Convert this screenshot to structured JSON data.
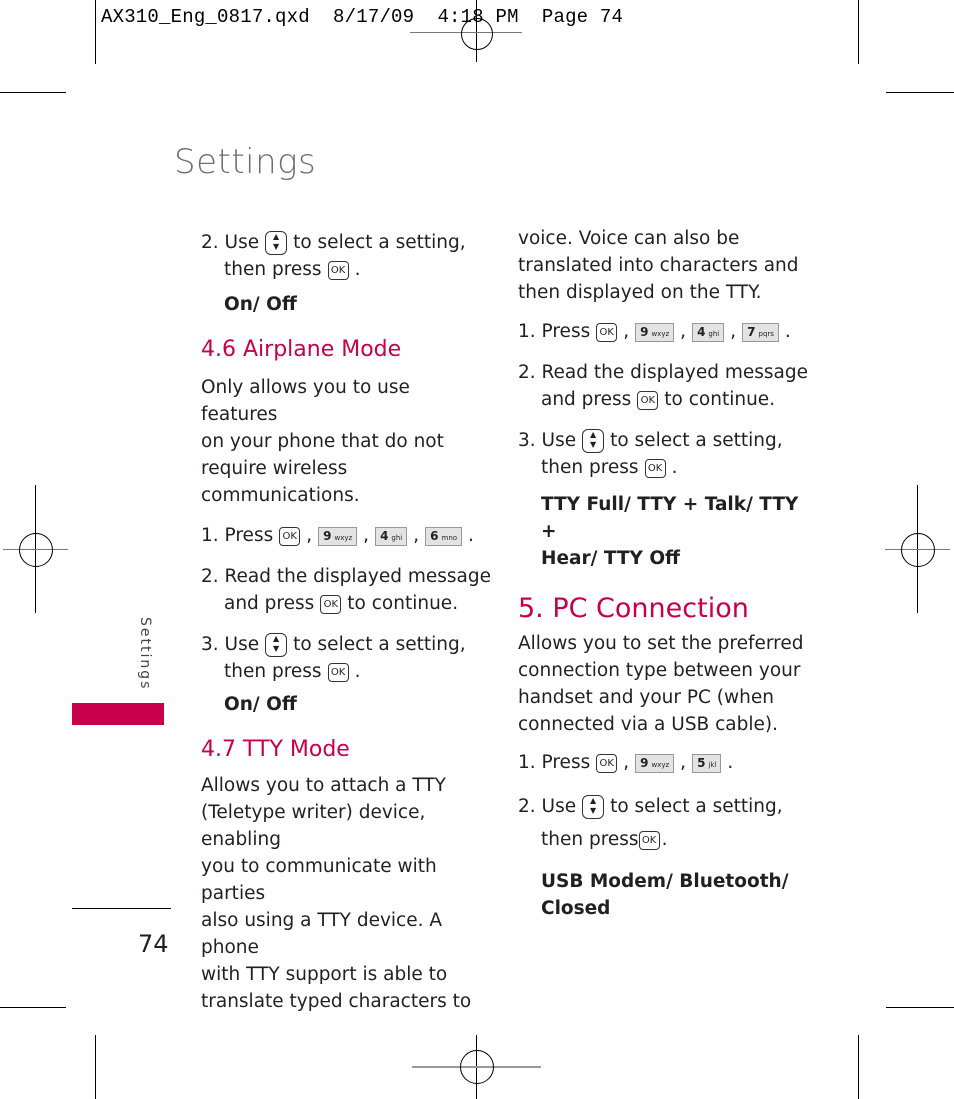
{
  "slug": "AX310_Eng_0817.qxd  8/17/09  4:18 PM  Page 74",
  "page_title": "Settings",
  "side_tab": "Settings",
  "page_number": "74",
  "colors": {
    "accent": "#c8004b",
    "title_gray": "#6d6e71"
  },
  "left_column": {
    "step2_use": "2. Use",
    "step2_select": "to select a setting,",
    "step2_then": "then press",
    "period": ".",
    "options1": "On/ Off",
    "airplane": {
      "heading": "4.6 Airplane Mode",
      "desc": [
        "Only allows you to use features",
        "on your phone that do not",
        "require wireless communications."
      ],
      "step1": "1. Press",
      "keys": [
        {
          "d": "9",
          "l": "wxyz"
        },
        {
          "d": "4",
          "l": "ghi"
        },
        {
          "d": "6",
          "l": "mno"
        }
      ],
      "step2a": "2. Read the displayed message",
      "step2b": "and press",
      "step2c": "to continue.",
      "step3_use": "3. Use",
      "step3_select": "to select a setting,",
      "step3_then": "then press",
      "options": "On/ Off"
    },
    "tty": {
      "heading": "4.7 TTY Mode",
      "desc": [
        "Allows you to attach a TTY",
        "(Teletype writer) device, enabling",
        "you to communicate with parties",
        "also using a TTY device. A phone",
        "with TTY support is able to",
        "translate typed characters to"
      ]
    }
  },
  "right_column": {
    "tty_cont": [
      "voice. Voice can also be",
      "translated into characters and",
      "then displayed on the TTY."
    ],
    "step1": "1. Press",
    "keys": [
      {
        "d": "9",
        "l": "wxyz"
      },
      {
        "d": "4",
        "l": "ghi"
      },
      {
        "d": "7",
        "l": "pqrs"
      }
    ],
    "step2a": "2. Read the displayed message",
    "step2b": "and press",
    "step2c": "to continue.",
    "step3_use": "3. Use",
    "step3_select": "to select a setting,",
    "step3_then": "then press",
    "options_l1": "TTY Full/ TTY + Talk/ TTY +",
    "options_l2": "Hear/ TTY Off",
    "pc": {
      "heading": "5. PC Connection",
      "desc": [
        "Allows you to set the preferred",
        "connection type between your",
        "handset and your PC (when",
        "connected via a USB cable)."
      ],
      "step1": "1. Press",
      "keys": [
        {
          "d": "9",
          "l": "wxyz"
        },
        {
          "d": "5",
          "l": "jkl"
        }
      ],
      "step2_use": "2. Use",
      "step2_select": "to select a setting,",
      "step2_then": "then press",
      "options_l1": "USB Modem/ Bluetooth/",
      "options_l2": "Closed"
    }
  },
  "icons": {
    "ok": "OK",
    "nav": "▲▼"
  }
}
